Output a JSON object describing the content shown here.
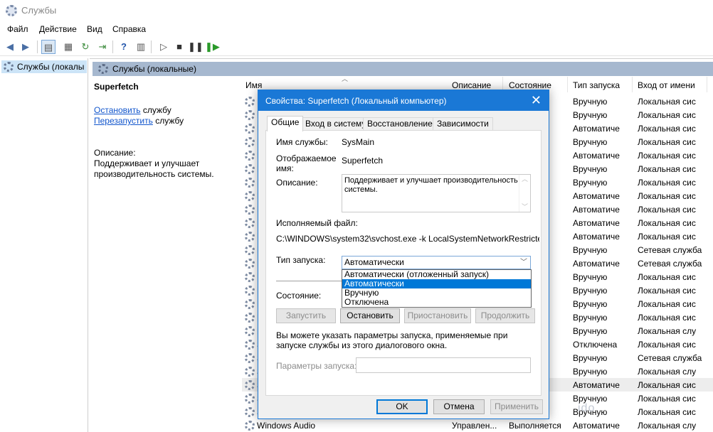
{
  "window": {
    "title": "Службы"
  },
  "menu": [
    "Файл",
    "Действие",
    "Вид",
    "Справка"
  ],
  "tree": {
    "selected": "Службы (локалы"
  },
  "pane_header": "Службы (локальные)",
  "extended": {
    "service_name": "Superfetch",
    "stop_link": "Остановить",
    "stop_suffix": " службу",
    "restart_link": "Перезапустить",
    "restart_suffix": " службу",
    "desc_label": "Описание:",
    "desc_text": "Поддерживает и улучшает производительность системы."
  },
  "columns": {
    "name": "Имя",
    "desc": "Описание",
    "status": "Состояние",
    "startup": "Тип запуска",
    "logon": "Вход от имени"
  },
  "rows": [
    {
      "name": "N",
      "desc": "",
      "status": "",
      "startup": "Вручную",
      "logon": "Локальная сис"
    },
    {
      "name": "N",
      "desc": "",
      "status": "",
      "startup": "Вручную",
      "logon": "Локальная сис"
    },
    {
      "name": "N",
      "desc": "",
      "status": "ется",
      "startup": "Автоматиче",
      "logon": "Локальная сис"
    },
    {
      "name": "N",
      "desc": "",
      "status": "",
      "startup": "Вручную",
      "logon": "Локальная сис"
    },
    {
      "name": "N",
      "desc": "",
      "status": "",
      "startup": "Автоматиче",
      "logon": "Локальная сис"
    },
    {
      "name": "N",
      "desc": "",
      "status": "",
      "startup": "Вручную",
      "logon": "Локальная сис"
    },
    {
      "name": "N",
      "desc": "",
      "status": "",
      "startup": "Вручную",
      "logon": "Локальная сис"
    },
    {
      "name": "N",
      "desc": "",
      "status": "",
      "startup": "Автоматиче",
      "logon": "Локальная сис"
    },
    {
      "name": "N",
      "desc": "",
      "status": "ется",
      "startup": "Автоматиче",
      "logon": "Локальная сис"
    },
    {
      "name": "N",
      "desc": "",
      "status": "ется",
      "startup": "Автоматиче",
      "logon": "Локальная сис"
    },
    {
      "name": "N",
      "desc": "",
      "status": "ется",
      "startup": "Автоматиче",
      "logon": "Локальная сис"
    },
    {
      "name": "N",
      "desc": "",
      "status": "",
      "startup": "Вручную",
      "logon": "Сетевая служба"
    },
    {
      "name": "N",
      "desc": "",
      "status": "ется",
      "startup": "Автоматиче",
      "logon": "Сетевая служба"
    },
    {
      "name": "N",
      "desc": "",
      "status": "",
      "startup": "Вручную",
      "logon": "Локальная сис"
    },
    {
      "name": "P",
      "desc": "",
      "status": "",
      "startup": "Вручную",
      "logon": "Локальная сис"
    },
    {
      "name": "P",
      "desc": "",
      "status": "ется",
      "startup": "Вручную",
      "logon": "Локальная сис"
    },
    {
      "name": "R",
      "desc": "",
      "status": "",
      "startup": "Вручную",
      "logon": "Локальная сис"
    },
    {
      "name": "R",
      "desc": "",
      "status": "",
      "startup": "Вручную",
      "logon": "Локальная слу"
    },
    {
      "name": "S",
      "desc": "",
      "status": "",
      "startup": "Отключена",
      "logon": "Локальная сис"
    },
    {
      "name": "S",
      "desc": "",
      "status": "",
      "startup": "Вручную",
      "logon": "Сетевая служба"
    },
    {
      "name": "S",
      "desc": "",
      "status": "ется",
      "startup": "Вручную",
      "logon": "Локальная слу"
    },
    {
      "name": "S",
      "desc": "",
      "status": "ется",
      "startup": "Автоматиче",
      "logon": "Локальная сис"
    },
    {
      "name": "S",
      "desc": "",
      "status": "",
      "startup": "Вручную",
      "logon": "Локальная сис"
    },
    {
      "name": "S",
      "desc": "",
      "status": "",
      "startup": "Вручную",
      "logon": "Локальная сис"
    },
    {
      "name": "Windows Audio",
      "desc": "Управлен...",
      "status": "Выполняется",
      "startup": "Автоматиче",
      "logon": "Локальная слу"
    }
  ],
  "selected_row_index": 21,
  "watermark": "ido",
  "dialog": {
    "title": "Свойства: Superfetch (Локальный компьютер)",
    "close_glyph": "✕",
    "tabs": [
      "Общие",
      "Вход в систему",
      "Восстановление",
      "Зависимости"
    ],
    "service_name_label": "Имя службы:",
    "service_name_value": "SysMain",
    "display_name_label_1": "Отображаемое",
    "display_name_label_2": "имя:",
    "display_name_value": "Superfetch",
    "description_label": "Описание:",
    "description_value": "Поддерживает и улучшает производительность системы.",
    "exe_label": "Исполняемый файл:",
    "exe_path": "C:\\WINDOWS\\system32\\svchost.exe -k LocalSystemNetworkRestricted -p",
    "startup_label": "Тип запуска:",
    "startup_value": "Автоматически",
    "startup_options": [
      "Автоматически (отложенный запуск)",
      "Автоматически",
      "Вручную",
      "Отключена"
    ],
    "startup_highlight_index": 1,
    "status_label": "Состояние:",
    "btn_start": "Запустить",
    "btn_stop": "Остановить",
    "btn_pause": "Приостановить",
    "btn_resume": "Продолжить",
    "note": "Вы можете указать параметры запуска, применяемые при запуске службы из этого диалогового окна.",
    "params_label": "Параметры запуска:",
    "params_value": "",
    "btn_ok": "OK",
    "btn_cancel": "Отмена",
    "btn_apply": "Применить"
  }
}
